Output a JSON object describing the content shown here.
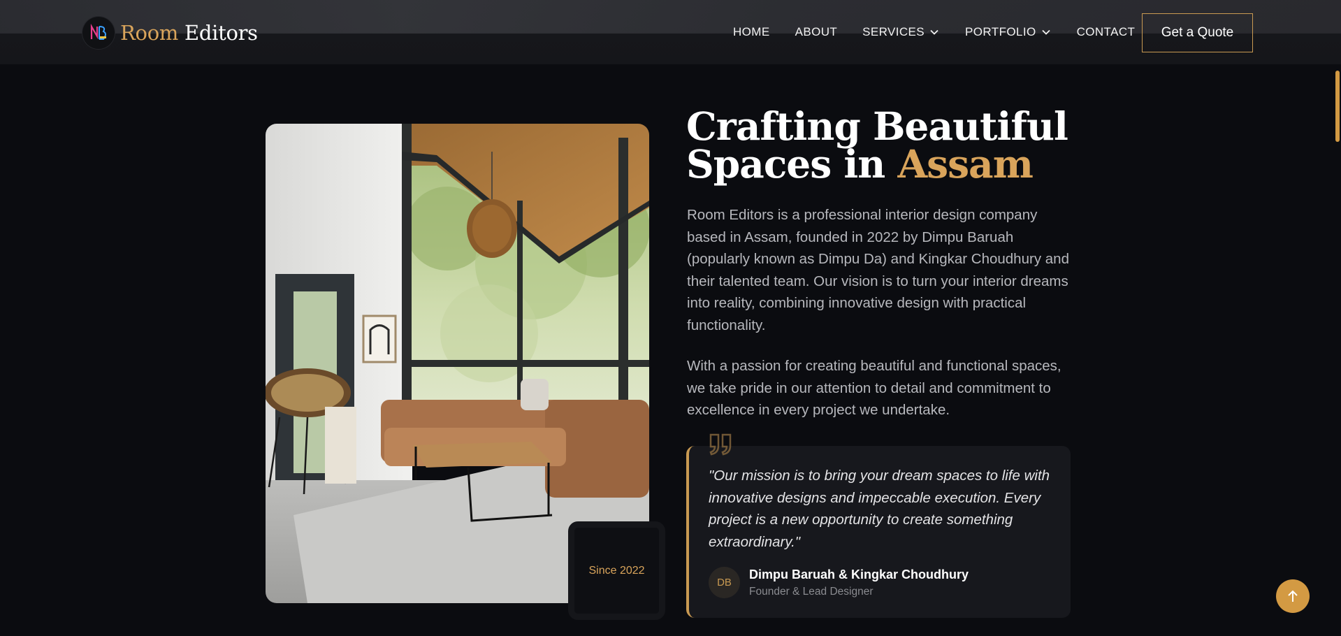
{
  "brand": {
    "name_part1": "Room",
    "name_part2": "Editors"
  },
  "nav": {
    "items": [
      {
        "label": "HOME",
        "dropdown": false
      },
      {
        "label": "ABOUT",
        "dropdown": false
      },
      {
        "label": "SERVICES",
        "dropdown": true
      },
      {
        "label": "PORTFOLIO",
        "dropdown": true
      },
      {
        "label": "CONTACT",
        "dropdown": false
      }
    ],
    "cta": "Get a Quote"
  },
  "hero": {
    "heading_line1": "Crafting Beautiful",
    "heading_line2": "Spaces in",
    "heading_highlight": "Assam",
    "paragraph1": "Room Editors is a professional interior design company based in Assam, founded in 2022 by Dimpu Baruah (popularly known as Dimpu Da) and Kingkar Choudhury and their talented team. Our vision is to turn your interior dreams into reality, combining innovative design with practical functionality.",
    "paragraph2": "With a passion for creating beautiful and functional spaces, we take pride in our attention to detail and commitment to excellence in every project we undertake.",
    "badge": "Since 2022"
  },
  "quote": {
    "text": "\"Our mission is to bring your dream spaces to life with innovative designs and impeccable execution. Every project is a new opportunity to create something extraordinary.\"",
    "avatar_initials": "DB",
    "author": "Dimpu Baruah & Kingkar Choudhury",
    "role": "Founder & Lead Designer"
  },
  "colors": {
    "accent": "#d9a45b",
    "background": "#0b0c10",
    "card": "#17181d"
  },
  "icons": [
    "logo-icon",
    "chevron-down-icon",
    "quote-icon",
    "arrow-up-icon"
  ]
}
